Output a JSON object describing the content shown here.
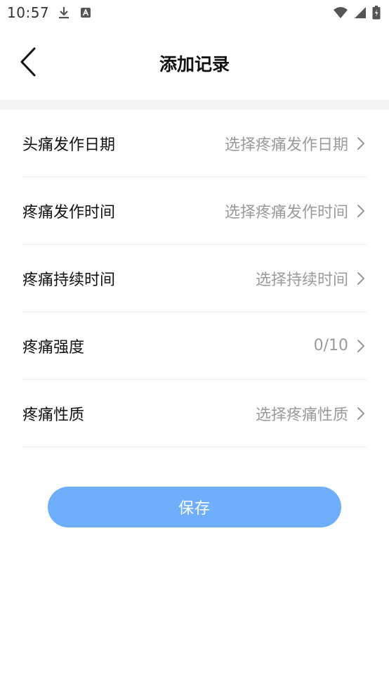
{
  "status_bar": {
    "time": "10:57"
  },
  "header": {
    "title": "添加记录"
  },
  "form": {
    "rows": [
      {
        "label": "头痛发作日期",
        "value": "选择疼痛发作日期"
      },
      {
        "label": "疼痛发作时间",
        "value": "选择疼痛发作时间"
      },
      {
        "label": "疼痛持续时间",
        "value": "选择持续时间"
      },
      {
        "label": "疼痛强度",
        "value": "0/10"
      },
      {
        "label": "疼痛性质",
        "value": "选择疼痛性质"
      }
    ]
  },
  "actions": {
    "save_label": "保存"
  },
  "colors": {
    "accent": "#6eaefa",
    "placeholder": "#9a9a9a",
    "divider": "#ececec",
    "section_gap": "#f4f4f4"
  }
}
